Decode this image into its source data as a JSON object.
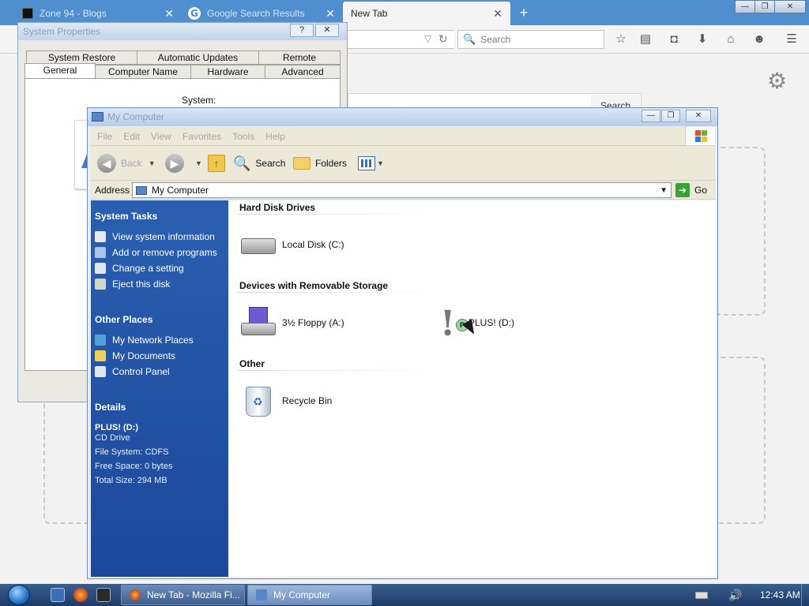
{
  "firefox": {
    "tabs": [
      {
        "label": "Zone 94 - Blogs"
      },
      {
        "label": "Google Search Results"
      },
      {
        "label": "New Tab"
      }
    ],
    "search_placeholder": "Search",
    "content_search_button": "Search",
    "window_controls": {
      "minimize": "—",
      "maximize": "❐",
      "close": "✕"
    },
    "new_tab": "+"
  },
  "system_properties": {
    "title": "System Properties",
    "help": "?",
    "close": "✕",
    "tabs_row1": [
      "System Restore",
      "Automatic Updates",
      "Remote"
    ],
    "tabs_row2": [
      "General",
      "Computer Name",
      "Hardware",
      "Advanced"
    ],
    "system_label": "System:"
  },
  "my_computer": {
    "title": "My Computer",
    "window_controls": {
      "minimize": "—",
      "maximize": "❐",
      "close": "✕"
    },
    "menu": [
      "File",
      "Edit",
      "View",
      "Favorites",
      "Tools",
      "Help"
    ],
    "toolbar": {
      "back": "Back",
      "search": "Search",
      "folders": "Folders"
    },
    "address": {
      "label": "Address",
      "value": "My Computer",
      "go": "Go"
    },
    "sidebar": {
      "system_tasks_heading": "System Tasks",
      "system_tasks": [
        "View system information",
        "Add or remove programs",
        "Change a setting",
        "Eject this disk"
      ],
      "other_places_heading": "Other Places",
      "other_places": [
        "My Network Places",
        "My Documents",
        "Control Panel"
      ],
      "details_heading": "Details",
      "details": {
        "name": "PLUS! (D:)",
        "type": "CD Drive",
        "file_system": "File System: CDFS",
        "free_space": "Free Space: 0 bytes",
        "total_size": "Total Size: 294 MB"
      }
    },
    "groups": {
      "hard_disk_heading": "Hard Disk Drives",
      "local_disk": "Local Disk (C:)",
      "removable_heading": "Devices with Removable Storage",
      "floppy": "3½ Floppy (A:)",
      "plus_drive": "PLUS! (D:)",
      "other_heading": "Other",
      "recycle_bin": "Recycle Bin"
    },
    "colors": {
      "sidebar": "#2a5fb0",
      "title_inactive": "#8aa0bc"
    }
  },
  "taskbar": {
    "buttons": [
      "New Tab - Mozilla Fi...",
      "My Computer"
    ],
    "clock": "12:43 AM"
  }
}
